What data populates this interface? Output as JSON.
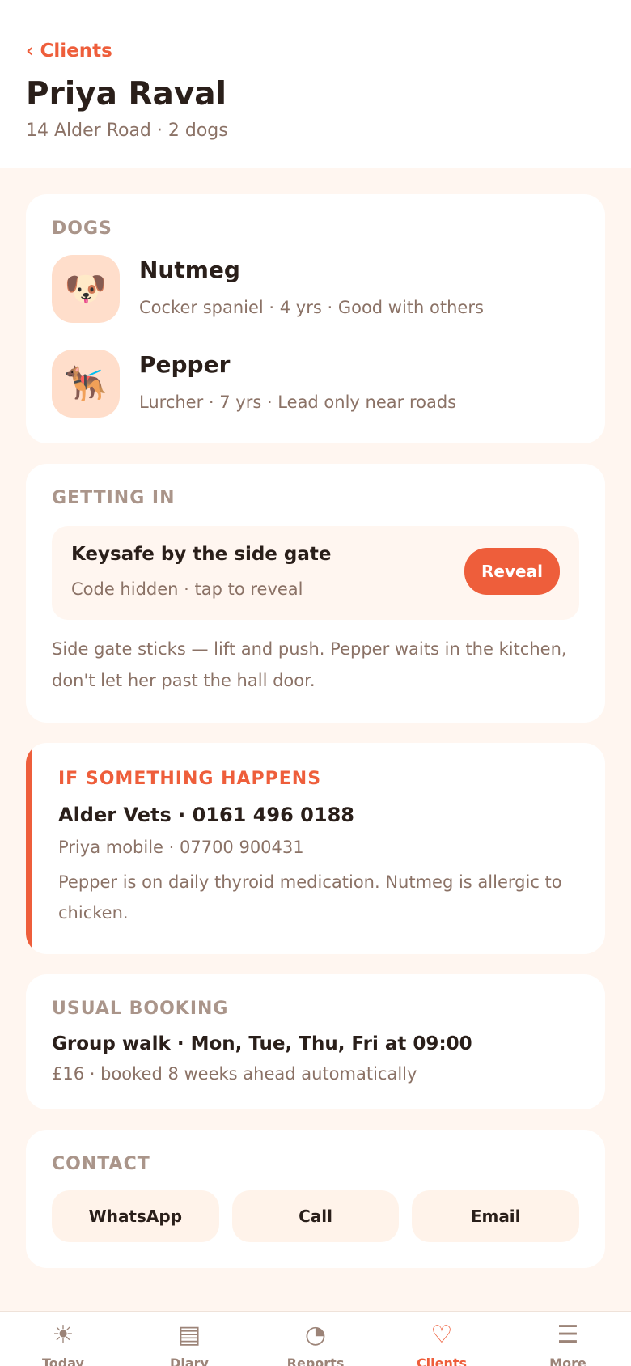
{
  "header": {
    "back_label": "‹ Clients",
    "title": "Priya Raval",
    "subtitle": "14 Alder Road · 2 dogs"
  },
  "dogs": {
    "title": "DOGS",
    "items": [
      {
        "name": "Nutmeg",
        "meta": "Cocker spaniel · 4 yrs · Good with others",
        "icon": "🐶",
        "icon_name": "puppy-icon"
      },
      {
        "name": "Pepper",
        "meta": "Lurcher · 7 yrs · Lead only near roads",
        "icon": "🐕‍🦺",
        "icon_name": "service-dog-icon"
      }
    ]
  },
  "access": {
    "title": "GETTING IN",
    "key_title": "Keysafe by the side gate",
    "key_sub": "Code hidden · tap to reveal",
    "reveal_label": "Reveal",
    "note": "Side gate sticks — lift and push. Pepper waits in the kitchen, don't let her past the hall door."
  },
  "emergency": {
    "title": "IF SOMETHING HAPPENS",
    "vet": "Alder Vets · 0161 496 0188",
    "mobile": "Priya mobile · 07700 900431",
    "note": "Pepper is on daily thyroid medication. Nutmeg is allergic to chicken."
  },
  "booking": {
    "title": "USUAL BOOKING",
    "schedule": "Group walk · Mon, Tue, Thu, Fri at 09:00",
    "price": "£16 · booked 8 weeks ahead automatically"
  },
  "contact": {
    "title": "CONTACT",
    "buttons": [
      "WhatsApp",
      "Call",
      "Email"
    ]
  },
  "nav": {
    "items": [
      {
        "label": "Today",
        "icon": "☀",
        "icon_name": "sun-icon",
        "active": false
      },
      {
        "label": "Diary",
        "icon": "▤",
        "icon_name": "diary-icon",
        "active": false
      },
      {
        "label": "Reports",
        "icon": "◔",
        "icon_name": "pie-chart-icon",
        "active": false
      },
      {
        "label": "Clients",
        "icon": "♡",
        "icon_name": "heart-icon",
        "active": true
      },
      {
        "label": "More",
        "icon": "☰",
        "icon_name": "menu-icon",
        "active": false
      }
    ]
  },
  "colors": {
    "accent": "#EE5E3B",
    "background": "#FFF6F0",
    "card": "#FFFFFF",
    "muted_text": "#8B7266",
    "section_title": "#AA958A"
  }
}
